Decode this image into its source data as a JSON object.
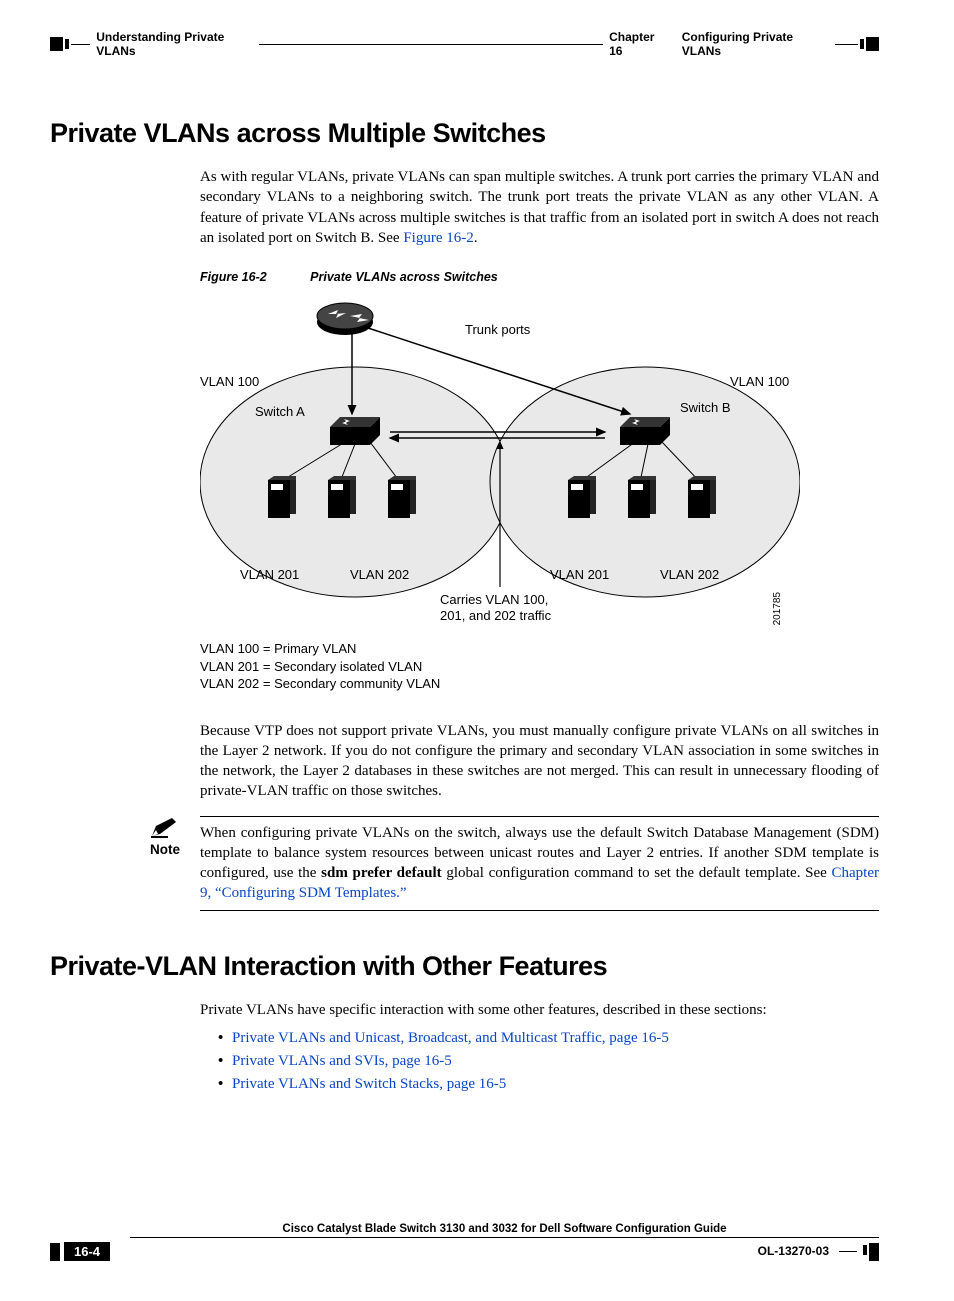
{
  "header": {
    "left": "Understanding Private VLANs",
    "right_prefix": "Chapter 16",
    "right_title": "Configuring Private VLANs"
  },
  "section1": {
    "title": "Private VLANs across Multiple Switches",
    "para1_a": "As with regular VLANs, private VLANs can span multiple switches. A trunk port carries the primary VLAN and secondary VLANs to a neighboring switch. The trunk port treats the private VLAN as any other VLAN. A feature of private VLANs across multiple switches is that traffic from an isolated port in switch A does not reach an isolated port on Switch B. See ",
    "para1_link": "Figure 16-2",
    "para1_b": ".",
    "figcap_num": "Figure 16-2",
    "figcap_title": "Private VLANs across Switches",
    "fig": {
      "trunk_label": "Trunk ports",
      "vlan100_l": "VLAN 100",
      "vlan100_r": "VLAN 100",
      "switch_a": "Switch A",
      "switch_b": "Switch B",
      "vlan201_l": "VLAN 201",
      "vlan202_l": "VLAN 202",
      "vlan201_r": "VLAN 201",
      "vlan202_r": "VLAN 202",
      "carries1": "Carries VLAN 100,",
      "carries2": "201, and 202 traffic",
      "imgnum": "201785"
    },
    "legend1": "VLAN 100 = Primary VLAN",
    "legend2": "VLAN 201 = Secondary isolated VLAN",
    "legend3": "VLAN 202 = Secondary community VLAN",
    "para2": "Because VTP does not support private VLANs, you must manually configure private VLANs on all switches in the Layer 2 network. If you do not configure the primary and secondary VLAN association in some switches in the network, the Layer 2 databases in these switches are not merged. This can result in unnecessary flooding of private-VLAN traffic on those switches."
  },
  "note": {
    "label": "Note",
    "text_a": "When configuring private VLANs on the switch, always use the default Switch Database Management (SDM) template to balance system resources between unicast routes and Layer 2 entries. If another SDM template is configured, use the ",
    "cmd": "sdm prefer default",
    "text_b": " global configuration command to set the default template. See ",
    "link": "Chapter 9, “Configuring SDM Templates.”"
  },
  "section2": {
    "title": "Private-VLAN Interaction with Other Features",
    "intro": "Private VLANs have specific interaction with some other features, described in these sections:",
    "links": [
      "Private VLANs and Unicast, Broadcast, and Multicast Traffic, page 16-5",
      "Private VLANs and SVIs, page 16-5",
      "Private VLANs and Switch Stacks, page 16-5"
    ]
  },
  "footer": {
    "guide": "Cisco Catalyst Blade Switch 3130 and 3032 for Dell Software Configuration Guide",
    "page": "16-4",
    "doc": "OL-13270-03"
  }
}
